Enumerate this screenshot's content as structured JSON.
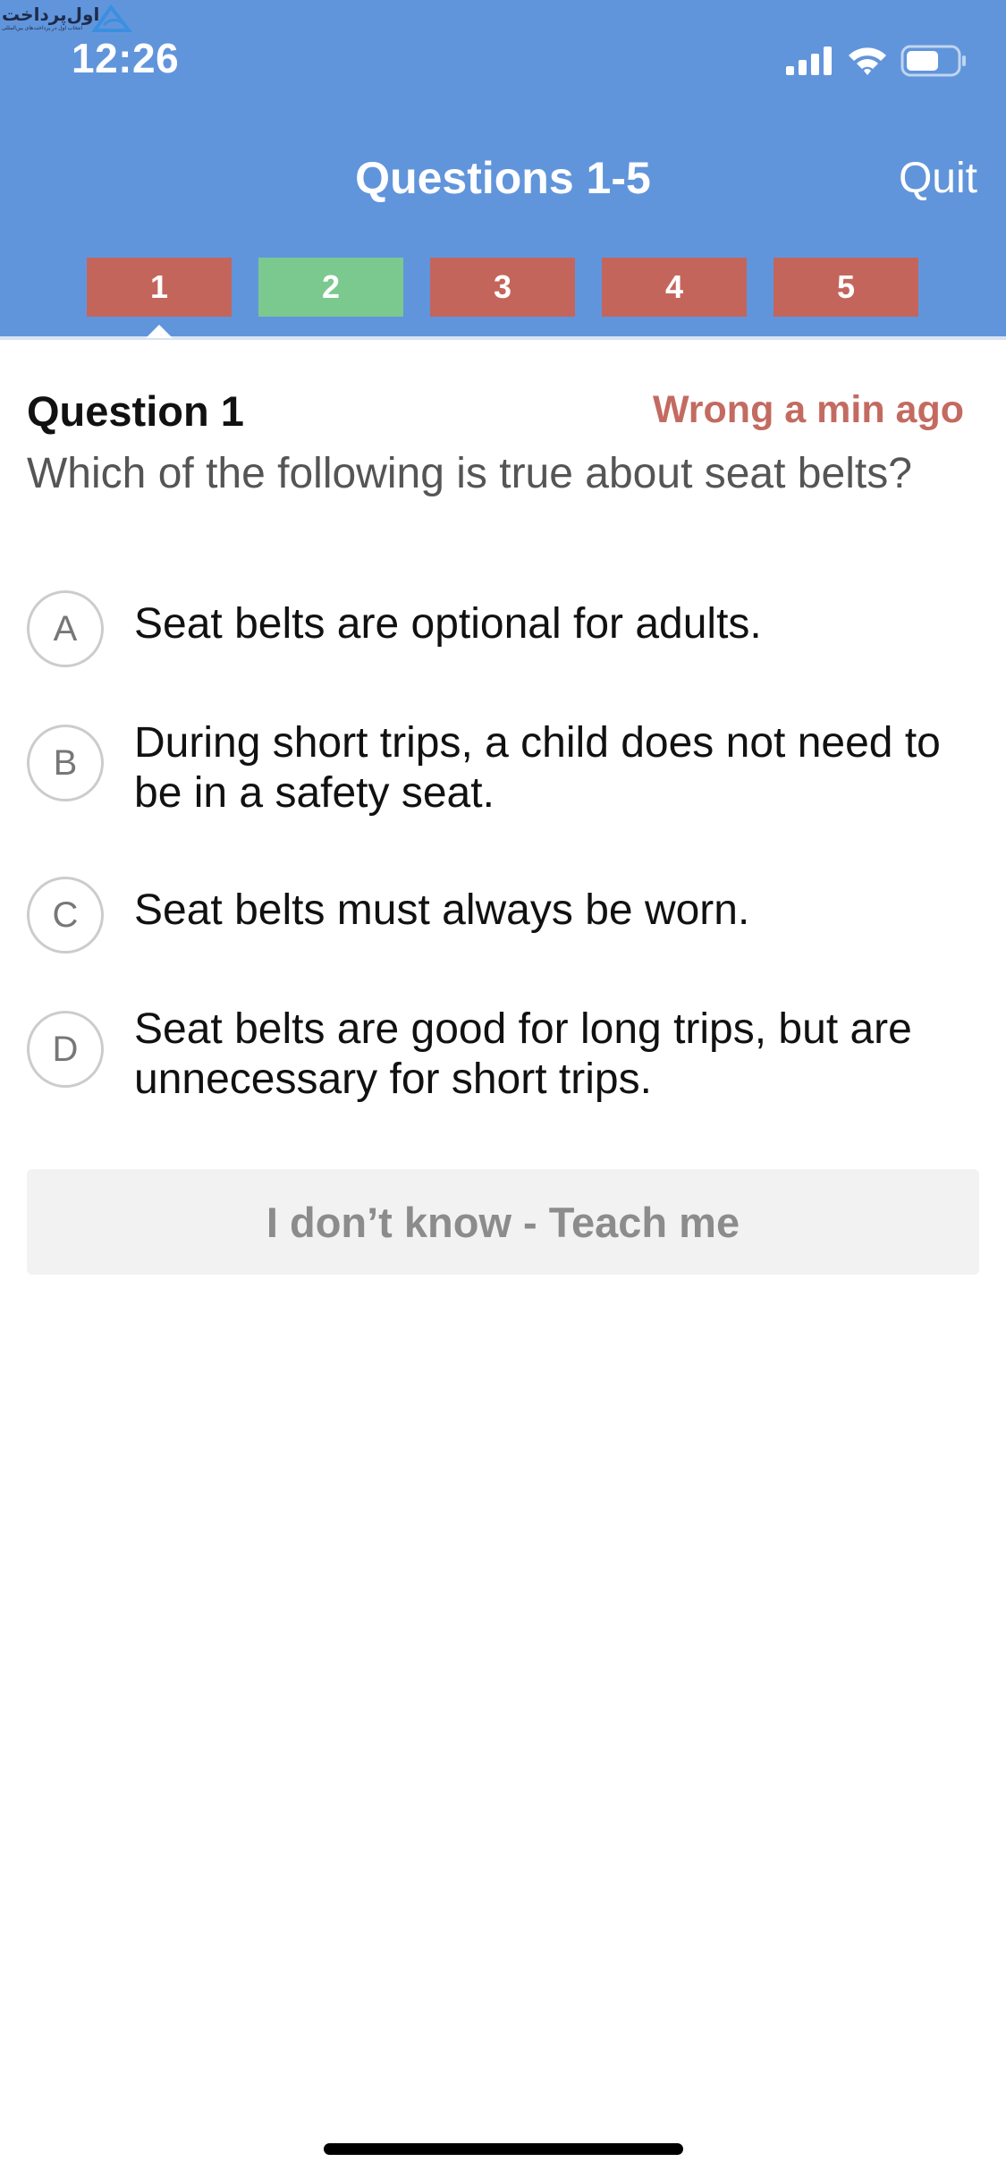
{
  "watermark": {
    "text": "اول‌پرداخت",
    "subtext": "انتخاب اول در پرداخت‌های بین‌المللی"
  },
  "status_bar": {
    "time": "12:26",
    "signal_icon": "cellular-signal-icon",
    "wifi_icon": "wifi-icon",
    "battery_icon": "battery-icon",
    "battery_level": 0.65
  },
  "nav": {
    "title": "Questions 1-5",
    "quit_label": "Quit"
  },
  "question_tabs": [
    {
      "label": "1",
      "state": "wrong",
      "color": "#C4655C",
      "selected": true
    },
    {
      "label": "2",
      "state": "correct",
      "color": "#7CC98F",
      "selected": false
    },
    {
      "label": "3",
      "state": "wrong",
      "color": "#C4655C",
      "selected": false
    },
    {
      "label": "4",
      "state": "wrong",
      "color": "#C4655C",
      "selected": false
    },
    {
      "label": "5",
      "state": "wrong",
      "color": "#C4655C",
      "selected": false
    }
  ],
  "question": {
    "heading": "Question 1",
    "status": "Wrong a min ago",
    "text": "Which of the following is true about seat belts?"
  },
  "options": [
    {
      "letter": "A",
      "text": "Seat belts are optional for adults."
    },
    {
      "letter": "B",
      "text": "During short trips, a child does not need to be in a safety seat."
    },
    {
      "letter": "C",
      "text": "Seat belts must always be worn."
    },
    {
      "letter": "D",
      "text": "Seat belts are good for long trips, but are unnecessary for short trips."
    }
  ],
  "teach_button_label": "I don’t know - Teach me",
  "colors": {
    "header": "#6195DB",
    "wrong": "#C4655C",
    "correct": "#7CC98F",
    "status_wrong_text": "#C36B61"
  }
}
